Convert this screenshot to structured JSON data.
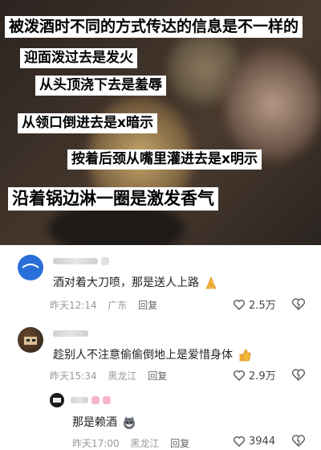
{
  "post": {
    "captions": [
      "被泼酒时不同的方式传达的信息是不一样的",
      "迎面泼过去是发火",
      "从头顶浇下去是羞辱",
      "从领口倒进去是x暗示",
      "按着后颈从嘴里灌进去是x明示",
      "沿着锅边淋一圈是激发香气"
    ]
  },
  "comments": [
    {
      "text": "酒对着大刀喷，那是送人上路",
      "emoji": "praying-hands-icon",
      "time": "昨天12:14",
      "location": "广东",
      "reply": "回复",
      "likes": "2.5万"
    },
    {
      "text": "趁别人不注意偷偷倒地上是爱惜身体",
      "emoji": "thumbs-up-icon",
      "time": "昨天15:34",
      "location": "黑龙江",
      "reply": "回复",
      "likes": "2.9万"
    },
    {
      "text": "那是赖酒",
      "emoji": "husky-icon",
      "time": "昨天17:00",
      "location": "黑龙江",
      "reply": "回复",
      "likes": "3944"
    }
  ],
  "colors": {
    "avatar_blue": "#2a6fd8",
    "heart_gray": "#555555",
    "badge_pink": "#f7b6c8"
  }
}
